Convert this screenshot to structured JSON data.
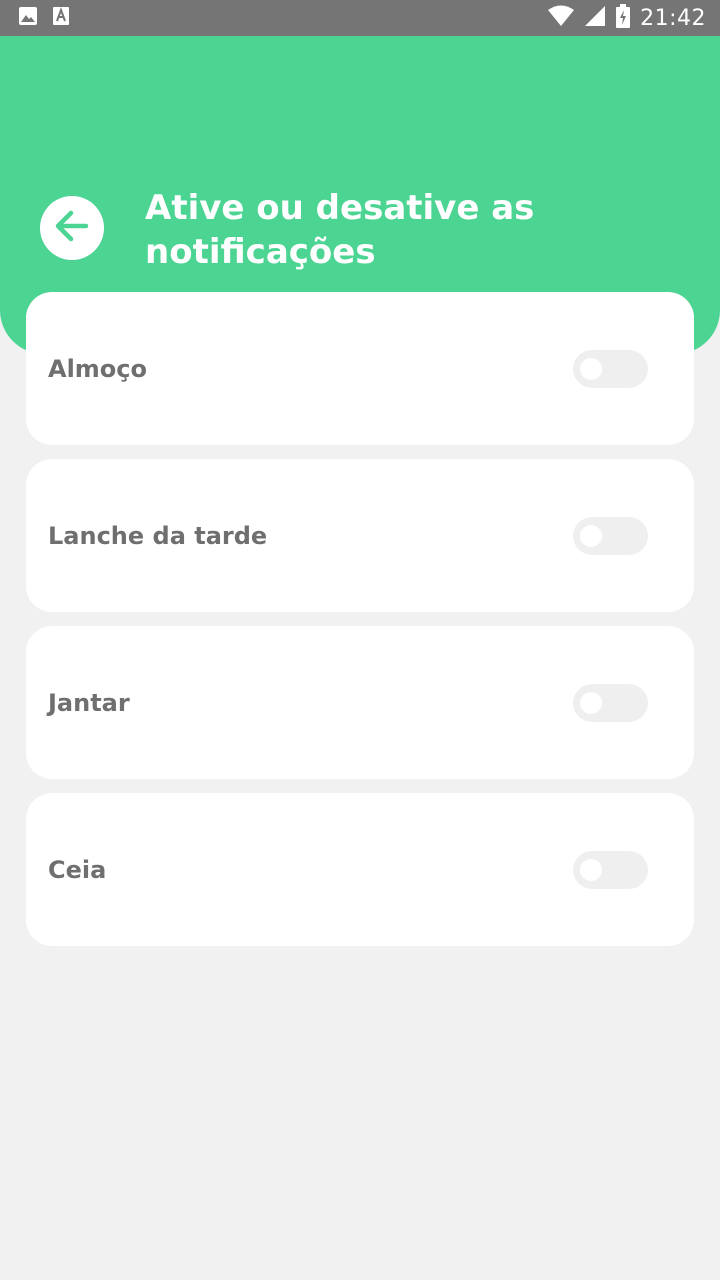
{
  "status_bar": {
    "time": "21:42",
    "icons": [
      "image-icon",
      "font-download-icon",
      "wifi-icon",
      "cell-signal-icon",
      "battery-charging-icon"
    ]
  },
  "header": {
    "title": "Ative ou desative as notificações",
    "back_icon": "arrow-left-icon",
    "background_color": "#4cd493"
  },
  "notifications": [
    {
      "label": "Almoço",
      "enabled": false
    },
    {
      "label": "Lanche da tarde",
      "enabled": false
    },
    {
      "label": "Jantar",
      "enabled": false
    },
    {
      "label": "Ceia",
      "enabled": false
    }
  ]
}
